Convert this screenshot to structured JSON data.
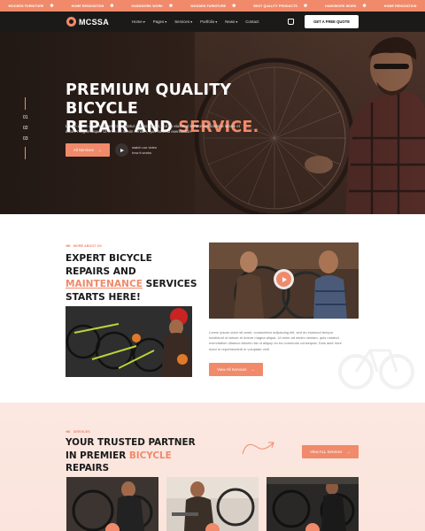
{
  "ticker": {
    "items": [
      "WOODEN FURNITURE",
      "HOME RENOVATION",
      "HANDWORK WORK",
      "WOODEN FURNITURE",
      "BEST QUALITY PRODUCTS",
      "HANDWORK WORK",
      "HOME RENOVATION"
    ]
  },
  "header": {
    "logo": "MCSSA",
    "nav": [
      "Home",
      "Pages",
      "Services",
      "Portfolio",
      "News",
      "Contact"
    ],
    "nav_dropdown": [
      true,
      true,
      true,
      true,
      true,
      false
    ],
    "active": 0,
    "quote_button": "GET A FREE QUOTE"
  },
  "hero": {
    "slides": [
      "01",
      "02",
      "03"
    ],
    "title_line1": "PREMIUM QUALITY BICYCLE",
    "title_line2_a": "REPAIR AND ",
    "title_line2_b": "SERVICE.",
    "description": "Lorem ipsum dolor sit amet, consectetur adipiscing elit, sed do eiusmod tempor incididunt ut labore et dolore magna aliqua. Ut enim ad minim veniam, quis nostrud exercitation",
    "button": "All Services",
    "watch_line1": "watch our video",
    "watch_line2": "how it works"
  },
  "about": {
    "tag": "MORE ABOUT US",
    "title_a": "EXPERT BICYCLE REPAIRS AND ",
    "title_b": "MAINTENANCE",
    "title_c": " SERVICES STARTS HERE!",
    "description": "Lorem ipsum dolor sit amet, consectetur adipiscing elit, sed do eiusmod tempor incididunt ut labore et dolore magna aliqua. Ut enim ad minim veniam, quis nostrud exercitation ullamco laboris nisi ut aliquip ex ea commodo consequat. Duis aute irure dolor in reprehenderit in voluptate velit",
    "button": "View All Services"
  },
  "services": {
    "tag": "SERVICES",
    "title_a": "YOUR TRUSTED PARTNER IN PREMIER ",
    "title_b": "BICYCLE",
    "title_c": " REPAIRS",
    "button": "View ALL Services"
  },
  "colors": {
    "accent": "#f08a6a",
    "dark": "#1c1a19",
    "ticker": "#f08a6a",
    "services_bg": "#fbe8e1"
  },
  "icons": [
    "star-icon",
    "bag-icon",
    "arrow-right-icon",
    "play-icon",
    "bicycle-icon",
    "chevron-down-icon"
  ]
}
